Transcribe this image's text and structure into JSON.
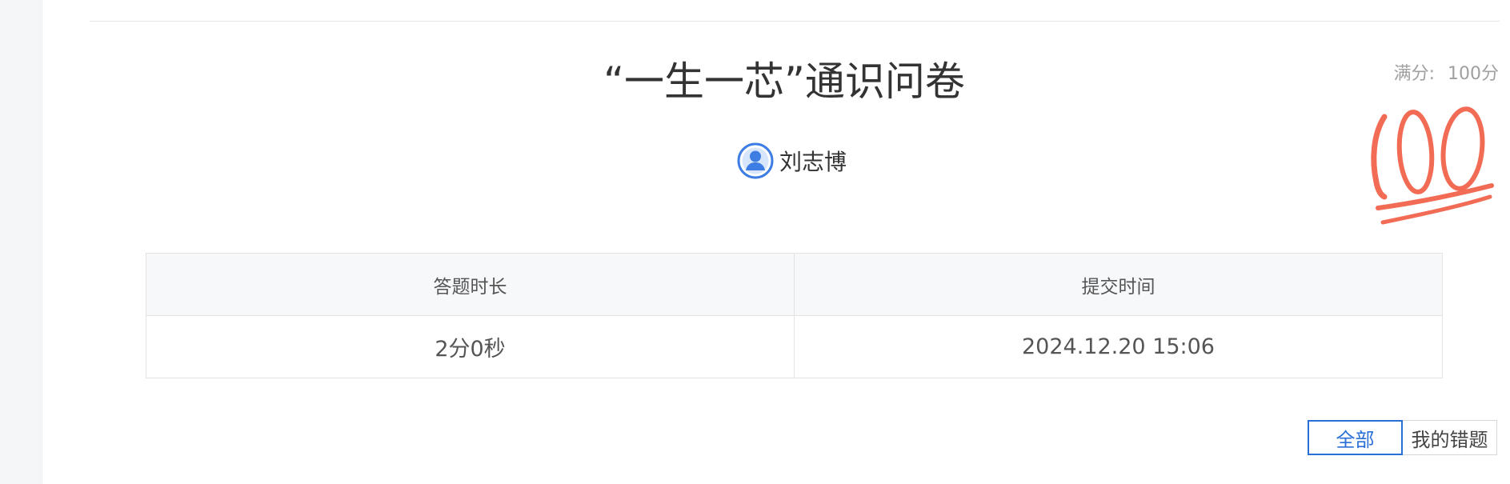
{
  "survey": {
    "title": "“一生一芯”通识问卷",
    "full_score_label": "满分:",
    "full_score_value": "100分",
    "score_stamp_icon": "100-score-stamp",
    "stamp_color": "#f26b55"
  },
  "user": {
    "name": "刘志博",
    "avatar_icon": "user-avatar-icon",
    "avatar_color": "#3d7de4"
  },
  "info_table": {
    "headers": [
      "答题时长",
      "提交时间"
    ],
    "values": [
      "2分0秒",
      "2024.12.20 15:06"
    ]
  },
  "filter": {
    "all_label": "全部",
    "wrong_label": "我的错题",
    "active": "全部",
    "accent_color": "#2a6fd6"
  }
}
